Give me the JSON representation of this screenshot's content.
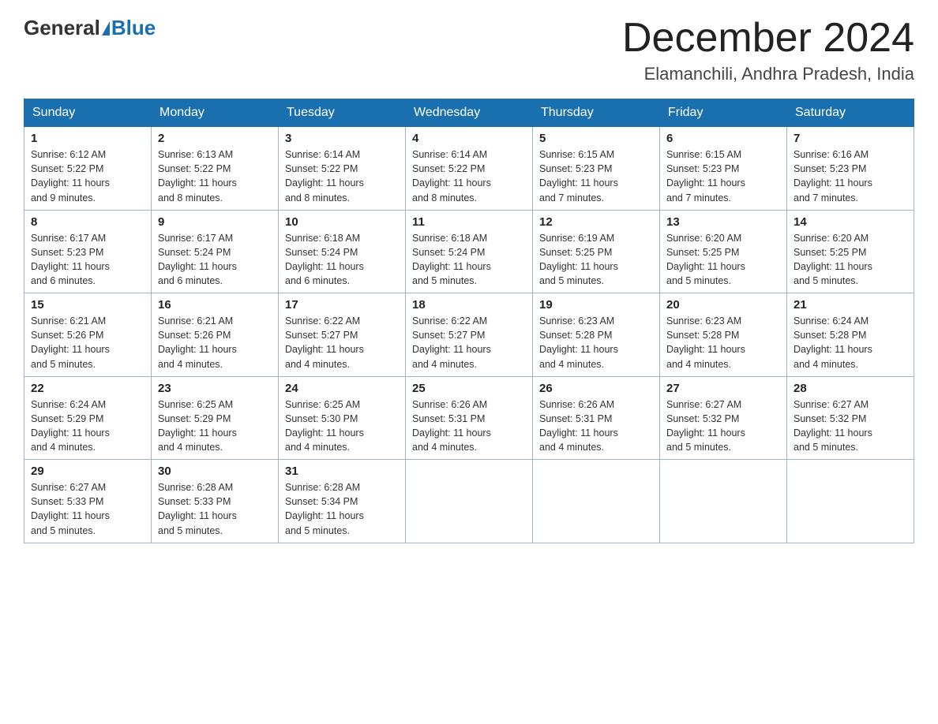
{
  "header": {
    "logo_general": "General",
    "logo_blue": "Blue",
    "title": "December 2024",
    "location": "Elamanchili, Andhra Pradesh, India"
  },
  "days_of_week": [
    "Sunday",
    "Monday",
    "Tuesday",
    "Wednesday",
    "Thursday",
    "Friday",
    "Saturday"
  ],
  "weeks": [
    [
      {
        "day": "1",
        "sunrise": "6:12 AM",
        "sunset": "5:22 PM",
        "daylight": "11 hours and 9 minutes."
      },
      {
        "day": "2",
        "sunrise": "6:13 AM",
        "sunset": "5:22 PM",
        "daylight": "11 hours and 8 minutes."
      },
      {
        "day": "3",
        "sunrise": "6:14 AM",
        "sunset": "5:22 PM",
        "daylight": "11 hours and 8 minutes."
      },
      {
        "day": "4",
        "sunrise": "6:14 AM",
        "sunset": "5:22 PM",
        "daylight": "11 hours and 8 minutes."
      },
      {
        "day": "5",
        "sunrise": "6:15 AM",
        "sunset": "5:23 PM",
        "daylight": "11 hours and 7 minutes."
      },
      {
        "day": "6",
        "sunrise": "6:15 AM",
        "sunset": "5:23 PM",
        "daylight": "11 hours and 7 minutes."
      },
      {
        "day": "7",
        "sunrise": "6:16 AM",
        "sunset": "5:23 PM",
        "daylight": "11 hours and 7 minutes."
      }
    ],
    [
      {
        "day": "8",
        "sunrise": "6:17 AM",
        "sunset": "5:23 PM",
        "daylight": "11 hours and 6 minutes."
      },
      {
        "day": "9",
        "sunrise": "6:17 AM",
        "sunset": "5:24 PM",
        "daylight": "11 hours and 6 minutes."
      },
      {
        "day": "10",
        "sunrise": "6:18 AM",
        "sunset": "5:24 PM",
        "daylight": "11 hours and 6 minutes."
      },
      {
        "day": "11",
        "sunrise": "6:18 AM",
        "sunset": "5:24 PM",
        "daylight": "11 hours and 5 minutes."
      },
      {
        "day": "12",
        "sunrise": "6:19 AM",
        "sunset": "5:25 PM",
        "daylight": "11 hours and 5 minutes."
      },
      {
        "day": "13",
        "sunrise": "6:20 AM",
        "sunset": "5:25 PM",
        "daylight": "11 hours and 5 minutes."
      },
      {
        "day": "14",
        "sunrise": "6:20 AM",
        "sunset": "5:25 PM",
        "daylight": "11 hours and 5 minutes."
      }
    ],
    [
      {
        "day": "15",
        "sunrise": "6:21 AM",
        "sunset": "5:26 PM",
        "daylight": "11 hours and 5 minutes."
      },
      {
        "day": "16",
        "sunrise": "6:21 AM",
        "sunset": "5:26 PM",
        "daylight": "11 hours and 4 minutes."
      },
      {
        "day": "17",
        "sunrise": "6:22 AM",
        "sunset": "5:27 PM",
        "daylight": "11 hours and 4 minutes."
      },
      {
        "day": "18",
        "sunrise": "6:22 AM",
        "sunset": "5:27 PM",
        "daylight": "11 hours and 4 minutes."
      },
      {
        "day": "19",
        "sunrise": "6:23 AM",
        "sunset": "5:28 PM",
        "daylight": "11 hours and 4 minutes."
      },
      {
        "day": "20",
        "sunrise": "6:23 AM",
        "sunset": "5:28 PM",
        "daylight": "11 hours and 4 minutes."
      },
      {
        "day": "21",
        "sunrise": "6:24 AM",
        "sunset": "5:28 PM",
        "daylight": "11 hours and 4 minutes."
      }
    ],
    [
      {
        "day": "22",
        "sunrise": "6:24 AM",
        "sunset": "5:29 PM",
        "daylight": "11 hours and 4 minutes."
      },
      {
        "day": "23",
        "sunrise": "6:25 AM",
        "sunset": "5:29 PM",
        "daylight": "11 hours and 4 minutes."
      },
      {
        "day": "24",
        "sunrise": "6:25 AM",
        "sunset": "5:30 PM",
        "daylight": "11 hours and 4 minutes."
      },
      {
        "day": "25",
        "sunrise": "6:26 AM",
        "sunset": "5:31 PM",
        "daylight": "11 hours and 4 minutes."
      },
      {
        "day": "26",
        "sunrise": "6:26 AM",
        "sunset": "5:31 PM",
        "daylight": "11 hours and 4 minutes."
      },
      {
        "day": "27",
        "sunrise": "6:27 AM",
        "sunset": "5:32 PM",
        "daylight": "11 hours and 5 minutes."
      },
      {
        "day": "28",
        "sunrise": "6:27 AM",
        "sunset": "5:32 PM",
        "daylight": "11 hours and 5 minutes."
      }
    ],
    [
      {
        "day": "29",
        "sunrise": "6:27 AM",
        "sunset": "5:33 PM",
        "daylight": "11 hours and 5 minutes."
      },
      {
        "day": "30",
        "sunrise": "6:28 AM",
        "sunset": "5:33 PM",
        "daylight": "11 hours and 5 minutes."
      },
      {
        "day": "31",
        "sunrise": "6:28 AM",
        "sunset": "5:34 PM",
        "daylight": "11 hours and 5 minutes."
      },
      null,
      null,
      null,
      null
    ]
  ],
  "labels": {
    "sunrise": "Sunrise:",
    "sunset": "Sunset:",
    "daylight": "Daylight:"
  }
}
